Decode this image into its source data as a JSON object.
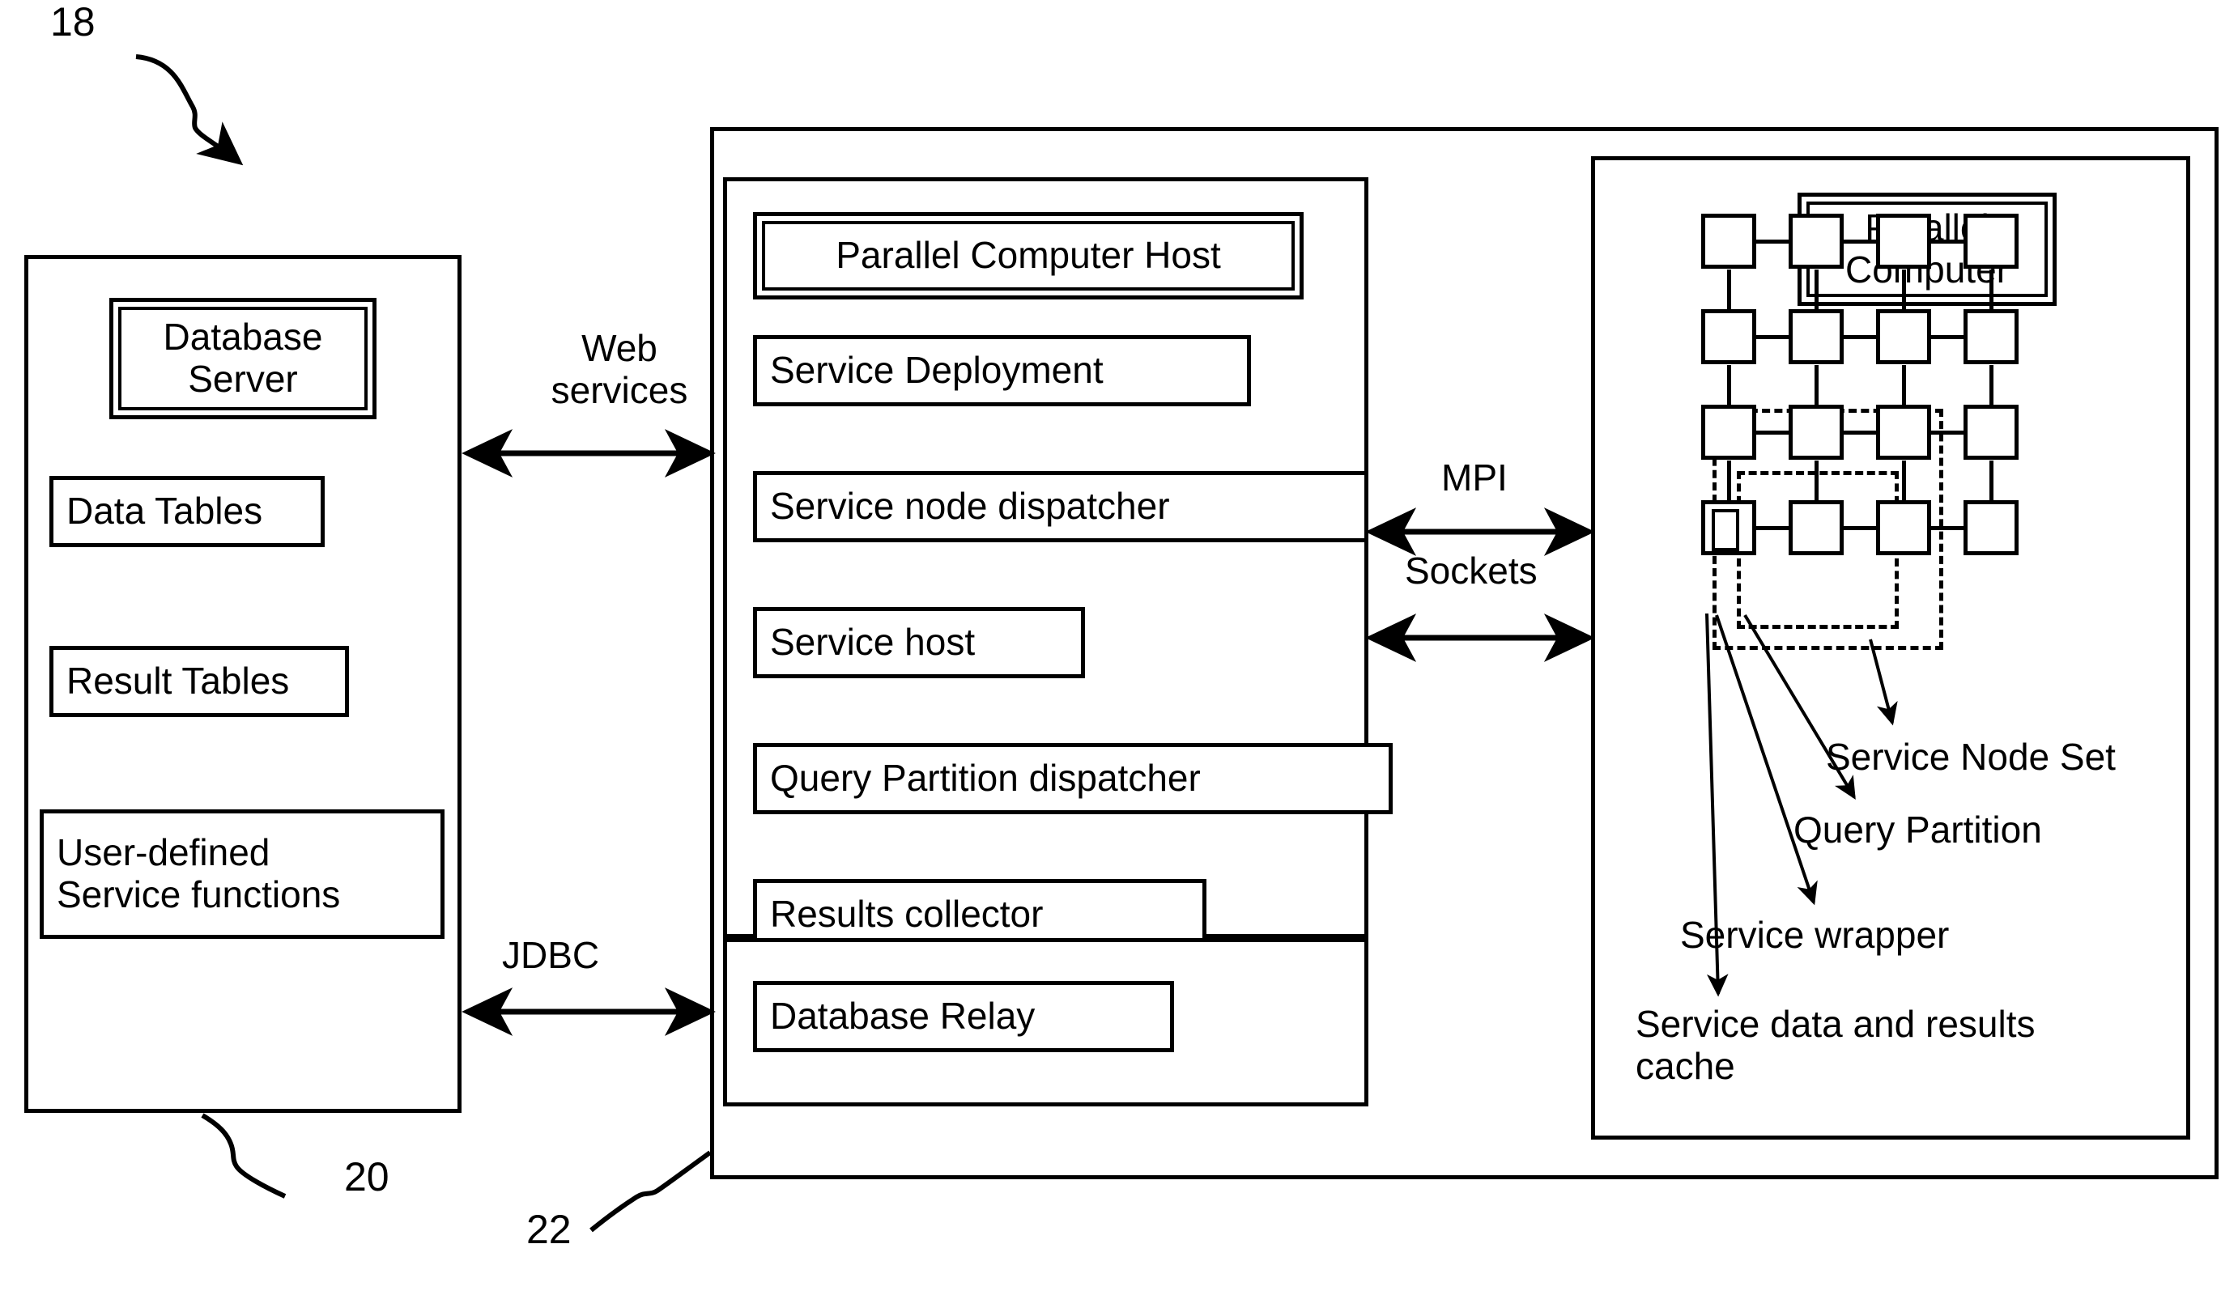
{
  "figure": {
    "ref_top": "18",
    "ref_left_panel": "20",
    "ref_center_panel": "22"
  },
  "left_panel": {
    "name": "database-server-panel",
    "title_box": {
      "label": "Database\nServer",
      "style": "double-border"
    },
    "items": [
      {
        "label": "Data Tables"
      },
      {
        "label": "Result Tables"
      },
      {
        "label": "User-defined\nService functions"
      }
    ]
  },
  "connectors": {
    "web_services": {
      "label": "Web\nservices"
    },
    "jdbc": {
      "label": "JDBC"
    },
    "mpi": {
      "label": "MPI"
    },
    "sockets": {
      "label": "Sockets"
    }
  },
  "center_panel": {
    "name": "parallel-computer-host-panel",
    "title_box": {
      "label": "Parallel Computer Host",
      "style": "double-border"
    },
    "items": [
      {
        "label": "Service Deployment"
      },
      {
        "label": "Service node dispatcher"
      },
      {
        "label": "Service host"
      },
      {
        "label": "Query Partition dispatcher"
      },
      {
        "label": "Results collector"
      }
    ],
    "relay_section": [
      {
        "label": "Database Relay"
      }
    ]
  },
  "right_panel": {
    "name": "parallel-computer-panel",
    "title_box": {
      "label": "Parallel\nComputer",
      "style": "double-border"
    },
    "mesh": {
      "rows": 4,
      "cols": 4,
      "dashed_groups": [
        {
          "name": "service-node-set"
        },
        {
          "name": "query-partition"
        }
      ],
      "tiny_box": {
        "name": "service-wrapper-cell"
      }
    },
    "callouts": [
      {
        "label": "Service Node Set"
      },
      {
        "label": "Query Partition"
      },
      {
        "label": "Service wrapper"
      },
      {
        "label": "Service data and results\ncache"
      }
    ]
  },
  "colors": {
    "stroke": "#000000",
    "background": "#ffffff"
  }
}
